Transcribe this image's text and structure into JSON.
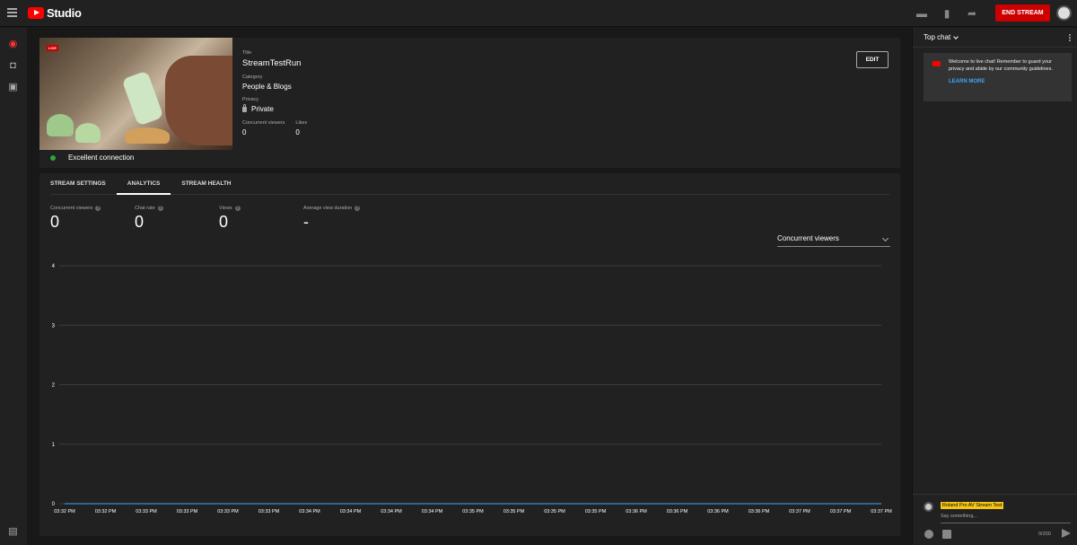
{
  "app": {
    "title": "Studio"
  },
  "topbar": {
    "end_stream_label": "END STREAM",
    "icons": [
      "clapperboard-icon",
      "bookmark-icon",
      "share-icon"
    ]
  },
  "leftrail": {
    "icons": [
      "live-icon",
      "camera-icon",
      "calendar-icon",
      "feedback-icon"
    ]
  },
  "preview": {
    "live_badge": "LIVE",
    "connection": "Excellent connection",
    "title_label": "Title",
    "title": "StreamTestRun",
    "category_label": "Category",
    "category": "People & Blogs",
    "privacy_label": "Privacy",
    "privacy": "Private",
    "concurrent_label": "Concurrent viewers",
    "concurrent": "0",
    "likes_label": "Likes",
    "likes": "0",
    "edit_label": "EDIT"
  },
  "tabs": [
    {
      "label": "STREAM SETTINGS"
    },
    {
      "label": "ANALYTICS"
    },
    {
      "label": "STREAM HEALTH"
    }
  ],
  "metrics": [
    {
      "label": "Concurrent viewers",
      "value": "0"
    },
    {
      "label": "Chat rate",
      "value": "0"
    },
    {
      "label": "Views",
      "value": "0"
    },
    {
      "label": "Average view duration",
      "value": "-"
    }
  ],
  "chart_selector": "Concurrent viewers",
  "chart_data": {
    "type": "line",
    "title": "",
    "xlabel": "",
    "ylabel": "",
    "ylim": [
      0,
      4
    ],
    "yticks": [
      0,
      1,
      2,
      3,
      4
    ],
    "grid": true,
    "x": [
      "03:32 PM",
      "03:32 PM",
      "03:33 PM",
      "03:33 PM",
      "03:33 PM",
      "03:33 PM",
      "03:34 PM",
      "03:34 PM",
      "03:34 PM",
      "03:34 PM",
      "03:35 PM",
      "03:35 PM",
      "03:35 PM",
      "03:35 PM",
      "03:36 PM",
      "03:36 PM",
      "03:36 PM",
      "03:36 PM",
      "03:37 PM",
      "03:37 PM",
      "03:37 PM"
    ],
    "series": [
      {
        "values": [
          0,
          0,
          0,
          0,
          0,
          0,
          0,
          0,
          0,
          0,
          0,
          0,
          0,
          0,
          0,
          0,
          0,
          0,
          0,
          0,
          0
        ]
      }
    ],
    "colors": {
      "grid": "#3d3d3d",
      "line": "#3ea6ff"
    }
  },
  "chat": {
    "header": "Top chat",
    "welcome": "Welcome to live chat! Remember to guard your privacy and abide by our community guidelines.",
    "learn_more": "LEARN MORE",
    "user_name": "Roland Pro AV Stream Test",
    "placeholder": "Say something...",
    "counter": "0/200"
  }
}
